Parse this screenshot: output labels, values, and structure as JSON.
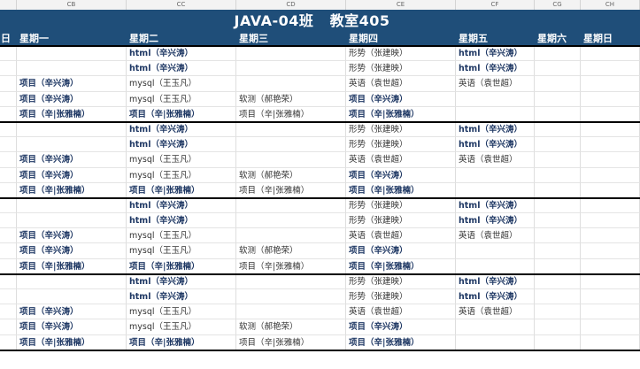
{
  "columns": [
    "CB",
    "CC",
    "CD",
    "CE",
    "CF",
    "CG",
    "CH"
  ],
  "title": "JAVA-04班   教室405",
  "day_headers": [
    "日",
    "星期一",
    "星期二",
    "星期三",
    "星期四",
    "星期五",
    "星期六",
    "星期日"
  ],
  "block": [
    [
      "",
      "html（辛兴涛）",
      "",
      "形势（张建映）",
      "html（辛兴涛）",
      "",
      ""
    ],
    [
      "",
      "html（辛兴涛）",
      "",
      "形势（张建映）",
      "html（辛兴涛）",
      "",
      ""
    ],
    [
      "项目（辛兴涛）",
      "mysql（王玉凡）",
      "",
      "英语（袁世超）",
      "英语（袁世超）",
      "",
      ""
    ],
    [
      "项目（辛兴涛）",
      "mysql（王玉凡）",
      "软测（郝艳荣）",
      "项目（辛兴涛）",
      "",
      "",
      ""
    ],
    [
      "项目（辛|张雅楠）",
      "项目（辛|张雅楠）",
      "项目（辛|张雅楠）",
      "项目（辛|张雅楠）",
      "",
      "",
      ""
    ]
  ],
  "bold_flags": [
    [
      false,
      true,
      false,
      false,
      true,
      false,
      false
    ],
    [
      false,
      true,
      false,
      false,
      true,
      false,
      false
    ],
    [
      true,
      false,
      false,
      false,
      false,
      false,
      false
    ],
    [
      true,
      false,
      false,
      true,
      false,
      false,
      false
    ],
    [
      true,
      true,
      false,
      true,
      false,
      false,
      false
    ]
  ]
}
